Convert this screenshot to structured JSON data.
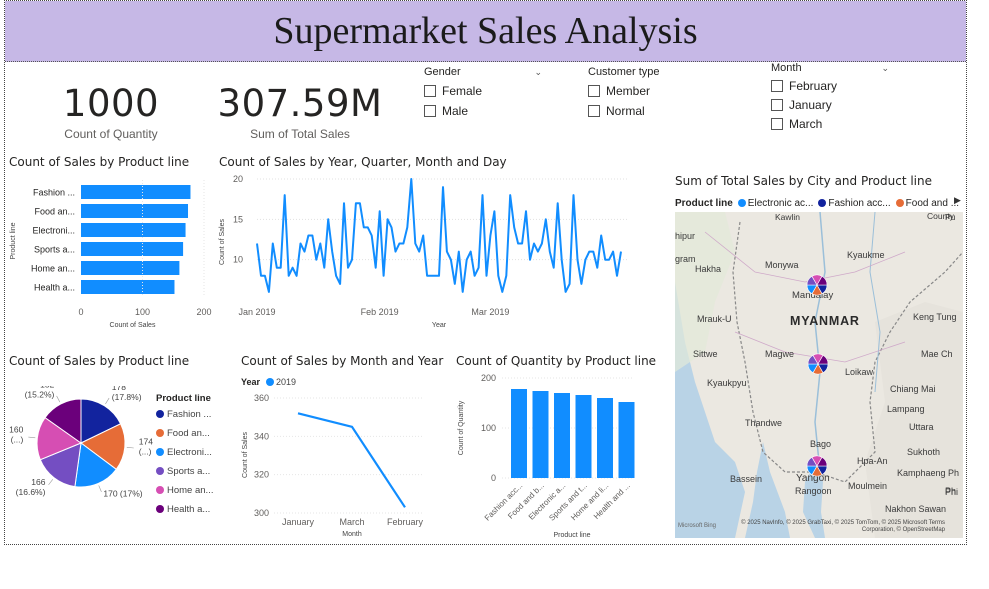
{
  "title": "Supermarket Sales Analysis",
  "kpis": [
    {
      "value": "1000",
      "label": "Count of Quantity"
    },
    {
      "value": "307.59M",
      "label": "Sum of Total Sales"
    }
  ],
  "slicers": {
    "gender": {
      "title": "Gender",
      "options": [
        "Female",
        "Male"
      ]
    },
    "customer_type": {
      "title": "Customer type",
      "options": [
        "Member",
        "Normal"
      ]
    },
    "month": {
      "title": "Month",
      "options": [
        "February",
        "January",
        "March"
      ]
    }
  },
  "visual_titles": {
    "bar_product": "Count of Sales by Product line",
    "line_date": "Count of Sales by Year, Quarter, Month and Day",
    "map": "Sum of Total Sales by City and Product line",
    "pie": "Count of Sales by Product line",
    "line_month": "Count of Sales by Month and Year",
    "col_qty": "Count of Quantity by Product line"
  },
  "colors": {
    "primary": "#118dff",
    "title_bg": "#c6b8e6",
    "pie": [
      "#12239e",
      "#e66c37",
      "#118dff",
      "#744ec2",
      "#d64eb3",
      "#6b007b"
    ]
  },
  "map": {
    "legend_title": "Product line",
    "legend": [
      {
        "name": "Electronic ac...",
        "color": "#118dff"
      },
      {
        "name": "Fashion acc...",
        "color": "#12239e"
      },
      {
        "name": "Food and ...",
        "color": "#e66c37"
      }
    ],
    "country": "MYANMAR",
    "places": [
      "Kawlin",
      "Kyaukme",
      "Monywa",
      "Mandalay",
      "Hakha",
      "Mrauk-U",
      "Keng Tung",
      "Sittwe",
      "Magwe",
      "Mae Ch",
      "Loikaw",
      "Kyaukpyu",
      "Chiang Mai",
      "Lampang",
      "Thandwe",
      "Uttara",
      "Bago",
      "Sukhoth",
      "Hpa-An",
      "Kamphaeng Ph",
      "Bassein",
      "Yangon",
      "Rangoon",
      "Moulmein",
      "Phi",
      "Nakhon Sawan",
      "County",
      "hipur",
      "gram",
      "Pu",
      "Ph"
    ],
    "attribution": "© 2025 NavInfo, © 2025 GrabTaxi, © 2025 TomTom, © 2025 Microsoft  Terms",
    "attribution2": "Corporation, © OpenStreetMap",
    "ms_label": "Microsoft Bing"
  },
  "chart_data": [
    {
      "type": "bar",
      "title": "Count of Sales by Product line",
      "categories": [
        "Fashion ...",
        "Food an...",
        "Electroni...",
        "Sports a...",
        "Home an...",
        "Health a..."
      ],
      "values": [
        178,
        174,
        170,
        166,
        160,
        152
      ],
      "xlabel": "Count of Sales",
      "ylabel": "Product line",
      "xlim": [
        0,
        200
      ],
      "ticks": [
        0,
        100,
        200
      ]
    },
    {
      "type": "line",
      "title": "Count of Sales by Year, Quarter, Month and Day",
      "xlabel": "Year",
      "ylabel": "Count of Sales",
      "ylim": [
        5,
        20
      ],
      "yticks": [
        10,
        15,
        20
      ],
      "xticks": [
        "Jan 2019",
        "Feb 2019",
        "Mar 2019"
      ],
      "values": [
        12,
        8,
        8,
        6,
        12,
        9,
        9,
        18,
        8,
        9,
        8,
        12,
        11,
        13,
        13,
        10,
        12,
        9,
        15,
        11,
        8,
        7,
        17,
        9,
        10,
        17,
        17,
        14,
        14,
        13,
        9,
        16,
        8,
        15,
        14,
        11,
        12,
        12,
        14,
        20,
        12,
        11,
        13,
        8,
        8,
        8,
        8,
        19,
        11,
        10,
        7,
        11,
        6,
        10,
        11,
        8,
        9,
        18,
        8,
        13,
        16,
        8,
        6,
        8,
        18,
        14,
        12,
        12,
        16,
        10,
        12,
        11,
        12,
        15,
        11,
        9,
        17,
        10,
        6,
        7,
        18,
        10,
        7,
        10,
        11,
        11,
        9,
        13,
        10,
        10,
        11,
        8,
        11
      ],
      "series_color": "#118dff"
    },
    {
      "type": "pie",
      "title": "Count of Sales by Product line",
      "legend_title": "Product line",
      "categories": [
        "Fashion ...",
        "Food an...",
        "Electroni...",
        "Sports a...",
        "Home an...",
        "Health a..."
      ],
      "values": [
        178,
        174,
        170,
        166,
        160,
        152
      ],
      "data_labels": [
        "178\n(17.8%)",
        "174\n(...)",
        "170 (17%)",
        "166\n(16.6%)",
        "160\n(...)",
        "152\n(15.2%)"
      ]
    },
    {
      "type": "line",
      "title": "Count of Sales by Month and Year",
      "legend_title": "Year",
      "series": [
        {
          "name": "2019",
          "values": [
            352,
            345,
            303
          ]
        }
      ],
      "categories": [
        "January",
        "March",
        "February"
      ],
      "xlabel": "Month",
      "ylabel": "Count of Sales",
      "ylim": [
        300,
        360
      ],
      "yticks": [
        300,
        320,
        340,
        360
      ]
    },
    {
      "type": "bar",
      "title": "Count of Quantity by Product line",
      "categories": [
        "Fashion acc...",
        "Food and b...",
        "Electronic a...",
        "Sports and t...",
        "Home and li...",
        "Health and ..."
      ],
      "values": [
        178,
        174,
        170,
        166,
        160,
        152
      ],
      "xlabel": "Product line",
      "ylabel": "Count of Quantity",
      "ylim": [
        0,
        200
      ],
      "yticks": [
        0,
        100,
        200
      ]
    }
  ]
}
